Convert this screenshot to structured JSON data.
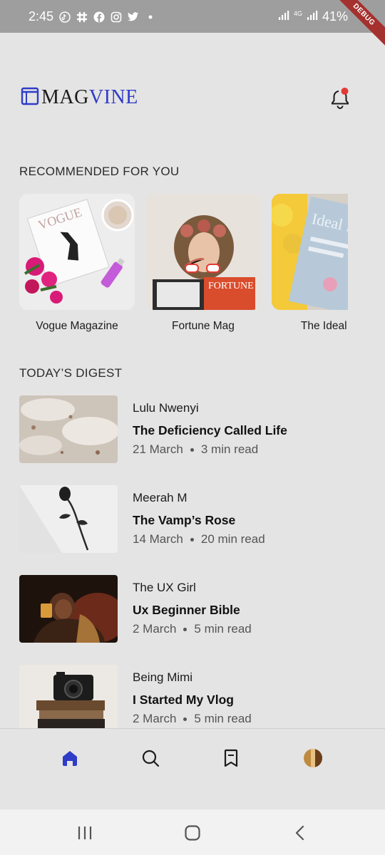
{
  "status_bar": {
    "time": "2:45",
    "battery": "41%",
    "network": "4G",
    "debug_label": "DEBUG",
    "icons": [
      "tiktok-icon",
      "slack-icon",
      "facebook-icon",
      "instagram-icon",
      "twitter-icon",
      "dot-icon",
      "signal-icon",
      "signal-icon"
    ]
  },
  "header": {
    "logo_part1": "MAG",
    "logo_part2": "VINE",
    "brand_color": "#2f3cc8",
    "notification_badge_color": "#e53935"
  },
  "recommended": {
    "title": "RECOMMENDED FOR YOU",
    "items": [
      {
        "name": "Vogue Magazine"
      },
      {
        "name": "Fortune Mag"
      },
      {
        "name": "The Ideal H"
      }
    ]
  },
  "digest": {
    "title": "TODAY’S DIGEST",
    "items": [
      {
        "author": "Lulu Nwenyi",
        "title": "The Deficiency Called Life",
        "date": "21 March",
        "read_time": "3 min read"
      },
      {
        "author": "Meerah M",
        "title": "The Vamp’s Rose",
        "date": "14 March",
        "read_time": "20 min read"
      },
      {
        "author": "The UX Girl",
        "title": "Ux Beginner Bible",
        "date": "2 March",
        "read_time": "5 min read"
      },
      {
        "author": "Being Mimi",
        "title": "I Started My Vlog",
        "date": "2 March",
        "read_time": "5 min read"
      }
    ]
  },
  "bottom_nav": {
    "items": [
      "home-icon",
      "search-icon",
      "bookmark-icon",
      "profile-avatar"
    ],
    "active": "home-icon",
    "active_color": "#2f3cc8"
  },
  "system_nav": [
    "recents-icon",
    "home-circle-icon",
    "back-icon"
  ]
}
